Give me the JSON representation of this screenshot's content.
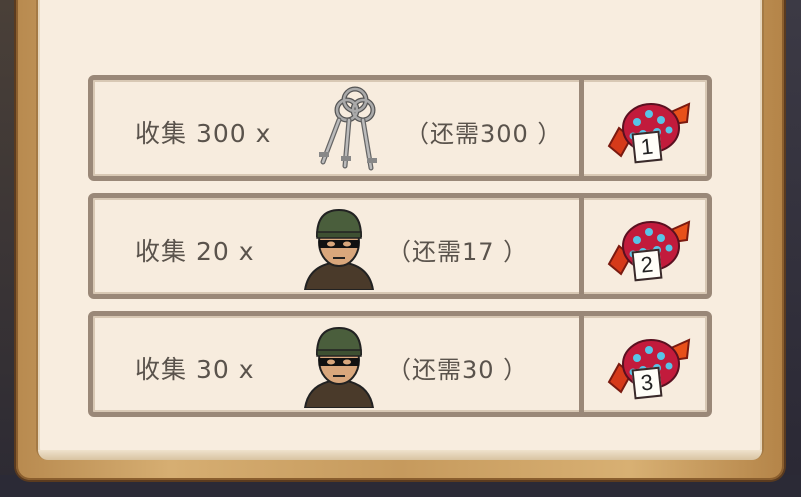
{
  "quests": [
    {
      "collect_text": "收集 300 x",
      "item": "keys-icon",
      "remaining_text": "（还需300 ）",
      "reward_number": "1"
    },
    {
      "collect_text": "收集 20 x",
      "item": "thief-icon",
      "remaining_text": "（还需17 ）",
      "reward_number": "2"
    },
    {
      "collect_text": "收集 30 x",
      "item": "thief-icon",
      "remaining_text": "（还需30 ）",
      "reward_number": "3"
    }
  ],
  "colors": {
    "panel": "#f8eddf",
    "border": "#9a8878",
    "frame": "#c69a5d",
    "text": "#5a534c",
    "reward_gift": "#c21b3c"
  }
}
